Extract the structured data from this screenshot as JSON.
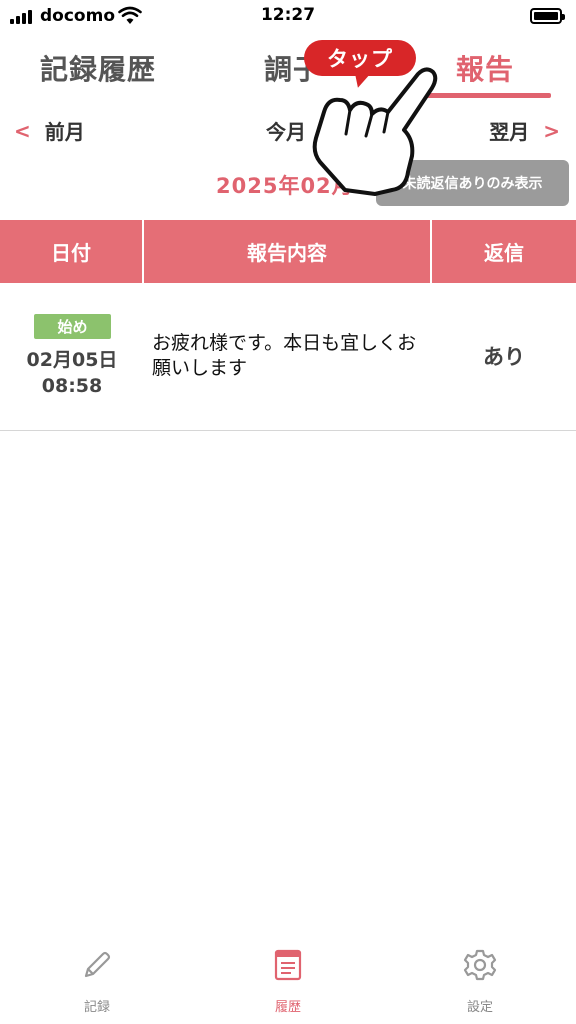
{
  "status_bar": {
    "carrier": "docomo",
    "time": "12:27"
  },
  "tabs": [
    {
      "label": "記録履歴"
    },
    {
      "label": "調子"
    },
    {
      "label": "報告",
      "active": true
    }
  ],
  "month_nav": {
    "prev": "前月",
    "current": "今月",
    "next": "翌月"
  },
  "current_month": "2025年02月",
  "filter_button": "未読返信ありのみ表示",
  "table": {
    "headers": [
      "日付",
      "報告内容",
      "返信"
    ],
    "rows": [
      {
        "badge": "始め",
        "date": "02月05日",
        "time": "08:58",
        "content": "お疲れ様です。本日も宜しくお願いします",
        "reply": "あり"
      }
    ]
  },
  "overlay": {
    "callout": "タップ"
  },
  "bottom_nav": [
    {
      "label": "記録",
      "icon": "pencil-icon"
    },
    {
      "label": "履歴",
      "icon": "document-icon",
      "active": true
    },
    {
      "label": "設定",
      "icon": "gear-icon"
    }
  ],
  "colors": {
    "accent": "#e0636f",
    "header_bg": "#e56e76",
    "badge": "#8cc26d",
    "callout": "#d82628",
    "filter_bg": "#9b9b9b"
  }
}
